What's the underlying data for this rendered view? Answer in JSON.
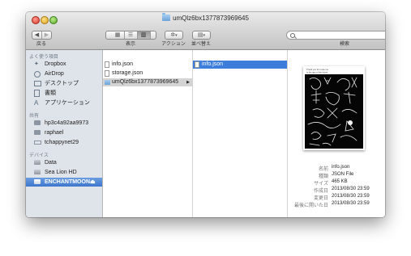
{
  "window": {
    "title": "umQlz6bx1377873969645"
  },
  "toolbar": {
    "back_label": "戻る",
    "view_label": "表示",
    "action_label": "アクション",
    "arrange_label": "並べ替え",
    "search_label": "検索",
    "search_placeholder": ""
  },
  "sidebar": {
    "favorites_header": "よく使う項目",
    "favorites": [
      {
        "label": "Dropbox",
        "icon": "dropbox-icon"
      },
      {
        "label": "AirDrop",
        "icon": "airdrop-icon"
      },
      {
        "label": "デスクトップ",
        "icon": "desktop-icon"
      },
      {
        "label": "書類",
        "icon": "documents-icon"
      },
      {
        "label": "アプリケーション",
        "icon": "applications-icon"
      }
    ],
    "shared_header": "共有",
    "shared": [
      {
        "label": "hp3c4a92aa9973",
        "icon": "computer-icon"
      },
      {
        "label": "raphael",
        "icon": "computer-icon"
      },
      {
        "label": "tchappynet29",
        "icon": "computer-icon"
      }
    ],
    "devices_header": "デバイス",
    "devices": [
      {
        "label": "Data",
        "icon": "drive-icon"
      },
      {
        "label": "Sea Lion HD",
        "icon": "drive-icon"
      },
      {
        "label": "ENCHANTMOON",
        "icon": "drive-icon",
        "selected": true
      }
    ]
  },
  "columns": {
    "col1": [
      {
        "label": "info.json"
      },
      {
        "label": "storage.json"
      },
      {
        "label": "umQlz6bx1377873969645",
        "selected": true,
        "folder": true
      }
    ],
    "col2": [
      {
        "label": "info.json",
        "selected": true
      }
    ]
  },
  "preview": {
    "thumbnail_texts": [
      "Thank you for invite me",
      "to the app of the future"
    ],
    "info": [
      {
        "key": "名前",
        "value": "info.json"
      },
      {
        "key": "種類",
        "value": "JSON File"
      },
      {
        "key": "サイズ",
        "value": "465 KB"
      },
      {
        "key": "作成日",
        "value": "2013/08/30 23:59"
      },
      {
        "key": "変更日",
        "value": "2013/08/30 23:59"
      },
      {
        "key": "最後に開いた日",
        "value": "2013/08/30 23:59"
      }
    ]
  },
  "colors": {
    "selection_blue": "#3d7ddb",
    "sidebar_bg": "#dfe4ea",
    "toolbar_top": "#e9e9e9",
    "toolbar_bottom": "#c3c3c3"
  }
}
